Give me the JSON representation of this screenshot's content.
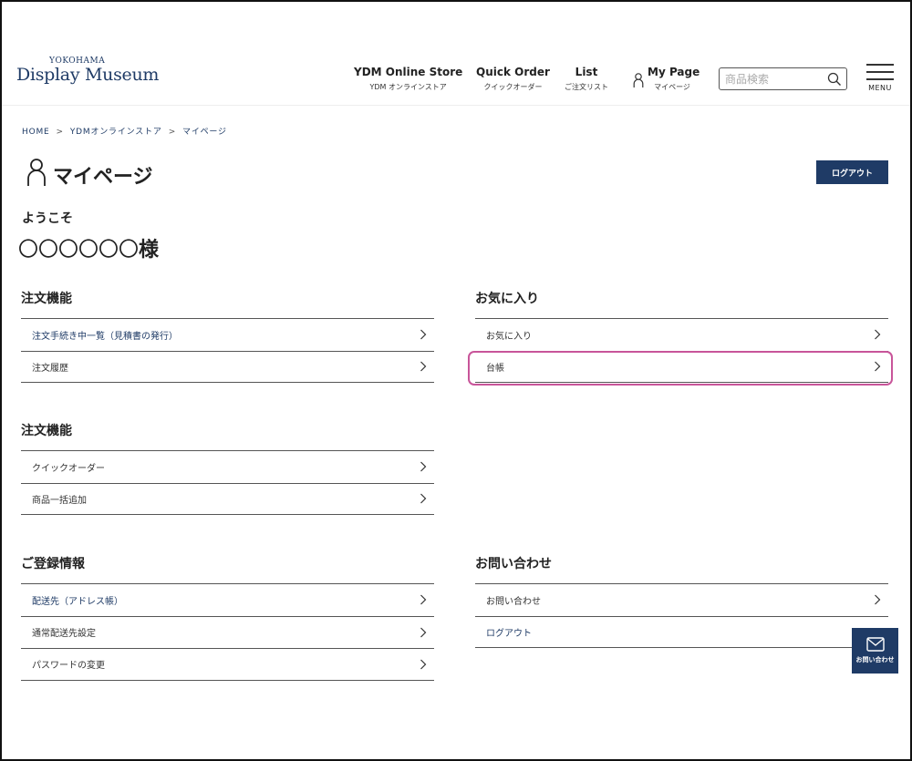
{
  "logo": {
    "sub": "YOKOHAMA",
    "main": "Display Museum"
  },
  "nav": [
    {
      "main": "YDM Online Store",
      "sub": "YDM オンラインストア"
    },
    {
      "main": "Quick Order",
      "sub": "クイックオーダー"
    },
    {
      "main": "List",
      "sub": "ご注文リスト"
    },
    {
      "main": "My Page",
      "sub": "マイページ"
    }
  ],
  "search": {
    "placeholder": "商品検索"
  },
  "menu": {
    "label": "MENU"
  },
  "breadcrumb": [
    "HOME",
    "YDMオンラインストア",
    "マイページ"
  ],
  "page": {
    "title": "マイページ",
    "logout_button": "ログアウト",
    "welcome": "ようこそ",
    "username": "〇〇〇〇〇〇",
    "honorific": "様"
  },
  "sections": {
    "order1": {
      "title": "注文機能",
      "items": [
        "注文手続き中一覧（見積書の発行）",
        "注文履歴"
      ]
    },
    "favorites": {
      "title": "お気に入り",
      "items": [
        "お気に入り",
        "台帳"
      ]
    },
    "order2": {
      "title": "注文機能",
      "items": [
        "クイックオーダー",
        "商品一括追加"
      ]
    },
    "registration": {
      "title": "ご登録情報",
      "items": [
        "配送先（アドレス帳）",
        "通常配送先設定",
        "パスワードの変更"
      ]
    },
    "contact": {
      "title": "お問い合わせ",
      "items": [
        "お問い合わせ",
        "ログアウト"
      ]
    }
  },
  "contact_button": {
    "label": "お問い合わせ"
  },
  "colors": {
    "navy": "#1f3b66",
    "highlight": "#c8559a"
  }
}
